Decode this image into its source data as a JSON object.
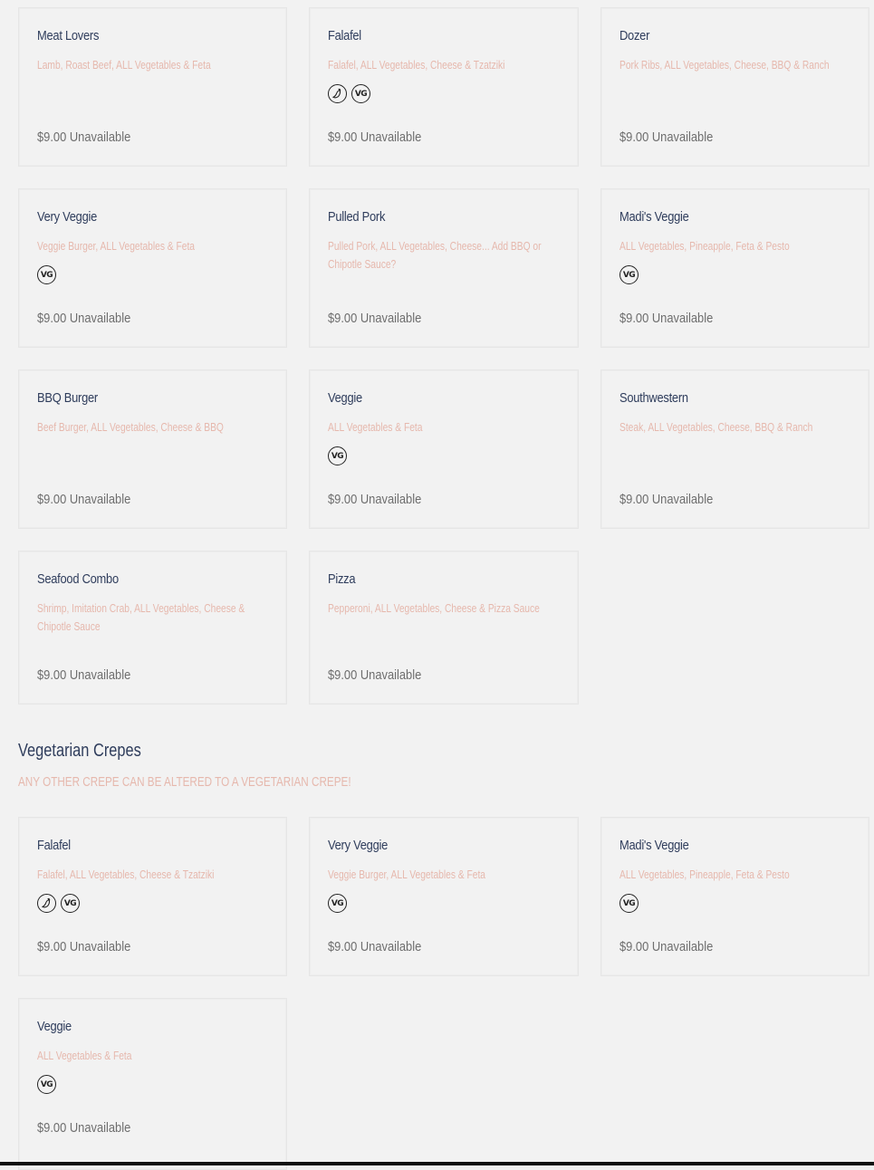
{
  "icons": {
    "spicy": "chili-icon",
    "vegetarian_label": "VG"
  },
  "colors": {
    "name": "#2f3d5c",
    "description": "#e6b8ad",
    "price": "#6e6e6e",
    "background": "#f2f2f2"
  },
  "menu_items": [
    {
      "name": "Meat Lovers",
      "description": "Lamb, Roast Beef, ALL Vegetables & Feta",
      "icons": [],
      "price": "$9.00 Unavailable"
    },
    {
      "name": "Falafel",
      "description": "Falafel, ALL Vegetables, Cheese & Tzatziki",
      "icons": [
        "spicy",
        "vegetarian"
      ],
      "price": "$9.00 Unavailable"
    },
    {
      "name": "Dozer",
      "description": "Pork Ribs, ALL Vegetables, Cheese, BBQ & Ranch",
      "icons": [],
      "price": "$9.00 Unavailable"
    },
    {
      "name": "Very Veggie",
      "description": "Veggie Burger, ALL Vegetables & Feta",
      "icons": [
        "vegetarian"
      ],
      "price": "$9.00 Unavailable"
    },
    {
      "name": "Pulled Pork",
      "description": "Pulled Pork, ALL Vegetables, Cheese... Add BBQ or Chipotle Sauce?",
      "icons": [],
      "price": "$9.00 Unavailable"
    },
    {
      "name": "Madi's Veggie",
      "description": "ALL Vegetables, Pineapple, Feta & Pesto",
      "icons": [
        "vegetarian"
      ],
      "price": "$9.00 Unavailable"
    },
    {
      "name": "BBQ Burger",
      "description": "Beef Burger, ALL Vegetables, Cheese & BBQ",
      "icons": [],
      "price": "$9.00 Unavailable"
    },
    {
      "name": "Veggie",
      "description": "ALL Vegetables & Feta",
      "icons": [
        "vegetarian"
      ],
      "price": "$9.00 Unavailable"
    },
    {
      "name": "Southwestern",
      "description": "Steak, ALL Vegetables, Cheese, BBQ & Ranch",
      "icons": [],
      "price": "$9.00 Unavailable"
    },
    {
      "name": "Seafood Combo",
      "description": "Shrimp, Imitation Crab, ALL Vegetables, Cheese & Chipotle Sauce",
      "icons": [],
      "price": "$9.00 Unavailable"
    },
    {
      "name": "Pizza",
      "description": "Pepperoni, ALL Vegetables, Cheese & Pizza Sauce",
      "icons": [],
      "price": "$9.00 Unavailable"
    }
  ],
  "vegetarian_section": {
    "title": "Vegetarian Crepes",
    "subtitle": "ANY OTHER CREPE CAN BE ALTERED TO A VEGETARIAN CREPE!",
    "items": [
      {
        "name": "Falafel",
        "description": "Falafel, ALL Vegetables, Cheese & Tzatziki",
        "icons": [
          "spicy",
          "vegetarian"
        ],
        "price": "$9.00 Unavailable"
      },
      {
        "name": "Very Veggie",
        "description": "Veggie Burger, ALL Vegetables & Feta",
        "icons": [
          "vegetarian"
        ],
        "price": "$9.00 Unavailable"
      },
      {
        "name": "Madi's Veggie",
        "description": "ALL Vegetables, Pineapple, Feta & Pesto",
        "icons": [
          "vegetarian"
        ],
        "price": "$9.00 Unavailable"
      },
      {
        "name": "Veggie",
        "description": "ALL Vegetables & Feta",
        "icons": [
          "vegetarian"
        ],
        "price": "$9.00 Unavailable"
      }
    ]
  }
}
